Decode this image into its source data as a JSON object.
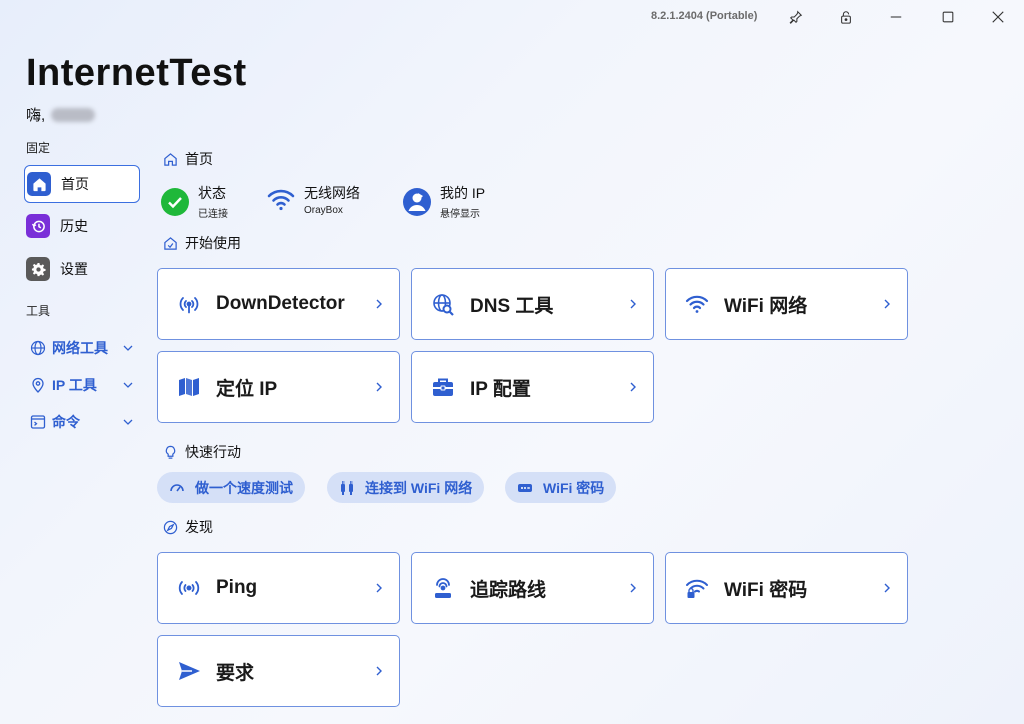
{
  "window": {
    "version": "8.2.1.2404 (Portable)",
    "app_title": "InternetTest",
    "greeting": "嗨,"
  },
  "sidebar": {
    "pinned_label": "固定",
    "items": [
      {
        "label": "首页",
        "icon": "home-icon",
        "color": "#2f5fd0"
      },
      {
        "label": "历史",
        "icon": "history-icon",
        "color": "#7a2fd8"
      },
      {
        "label": "设置",
        "icon": "gear-icon",
        "color": "#5a5a5a"
      }
    ],
    "tools_label": "工具",
    "tools": [
      {
        "label": "网络工具",
        "icon": "globe-icon"
      },
      {
        "label": "IP 工具",
        "icon": "location-pin-icon"
      },
      {
        "label": "命令",
        "icon": "command-window-icon"
      }
    ]
  },
  "main": {
    "home_heading": "首页",
    "status": [
      {
        "title": "状态",
        "sub": "已连接",
        "icon": "check-circle-icon",
        "color": "#1fb83a"
      },
      {
        "title": "无线网络",
        "sub": "OrayBox",
        "icon": "wifi-icon",
        "color": "#2f5fd0"
      },
      {
        "title": "我的 IP",
        "sub": "悬停显示",
        "icon": "user-circle-icon",
        "color": "#2f5fd0"
      }
    ],
    "getting_started_heading": "开始使用",
    "start_cards": [
      {
        "label": "DownDetector",
        "icon": "signal-tower-icon"
      },
      {
        "label": "DNS 工具",
        "icon": "dns-search-icon"
      },
      {
        "label": "WiFi 网络",
        "icon": "wifi-icon"
      },
      {
        "label": "定位 IP",
        "icon": "map-icon"
      },
      {
        "label": "IP 配置",
        "icon": "toolbox-icon"
      }
    ],
    "quick_actions_heading": "快速行动",
    "quick_actions": [
      {
        "label": "做一个速度测试",
        "icon": "speedometer-icon"
      },
      {
        "label": "连接到 WiFi 网络",
        "icon": "plug-icon"
      },
      {
        "label": "WiFi 密码",
        "icon": "password-icon"
      }
    ],
    "discover_heading": "发现",
    "discover_cards": [
      {
        "label": "Ping",
        "icon": "ping-icon"
      },
      {
        "label": "追踪路线",
        "icon": "route-icon"
      },
      {
        "label": "WiFi 密码",
        "icon": "wifi-lock-icon"
      },
      {
        "label": "要求",
        "icon": "send-icon"
      }
    ]
  },
  "colors": {
    "accent": "#2f5fd0",
    "card_border": "#6f91e0",
    "pill_bg": "#d5e0f7",
    "success": "#1fb83a"
  }
}
